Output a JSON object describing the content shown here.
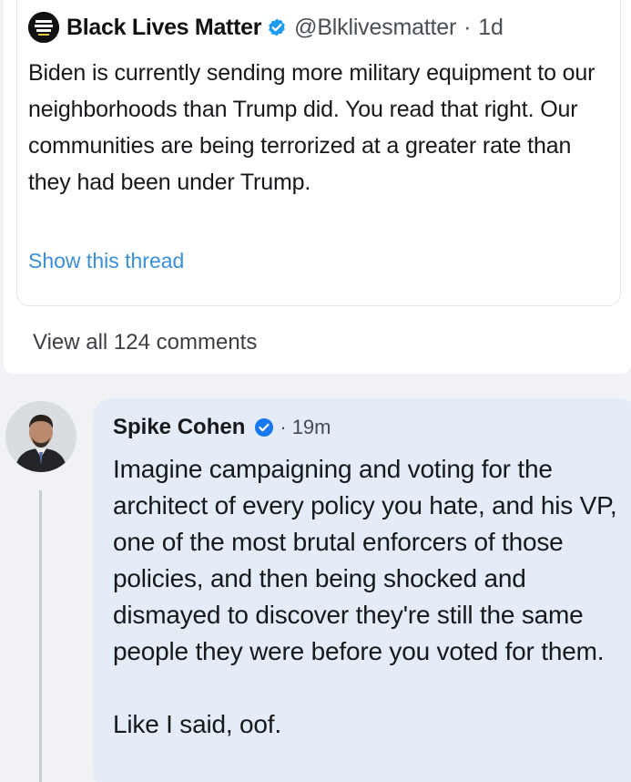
{
  "tweet": {
    "display_name": "Black Lives Matter",
    "handle": "@Blklivesmatter",
    "separator": "·",
    "age": "1d",
    "text": "Biden is currently sending more military equipment to our neighborhoods than Trump did. You read that right. Our communities are being terrorized at a greater rate than they had been under Trump.",
    "show_thread_label": "Show this thread",
    "avatar_icon": "blm-logo-icon",
    "verified_icon": "verified-badge-icon"
  },
  "post": {
    "view_comments_label": "View all 124 comments"
  },
  "comment": {
    "author": "Spike Cohen",
    "separator": "·",
    "age": "19m",
    "paragraph_1": "Imagine campaigning and voting for the architect of every policy you hate, and his VP, one of the most brutal enforcers of those policies, and then being shocked and dismayed to discover they're still the same people they were before you voted for them.",
    "paragraph_2": "Like I said, oof.",
    "verified_icon": "verified-badge-icon",
    "bubble_color": "#e4ecf7"
  },
  "colors": {
    "link": "#3a8fd6",
    "verified": "#1d9bf0"
  }
}
